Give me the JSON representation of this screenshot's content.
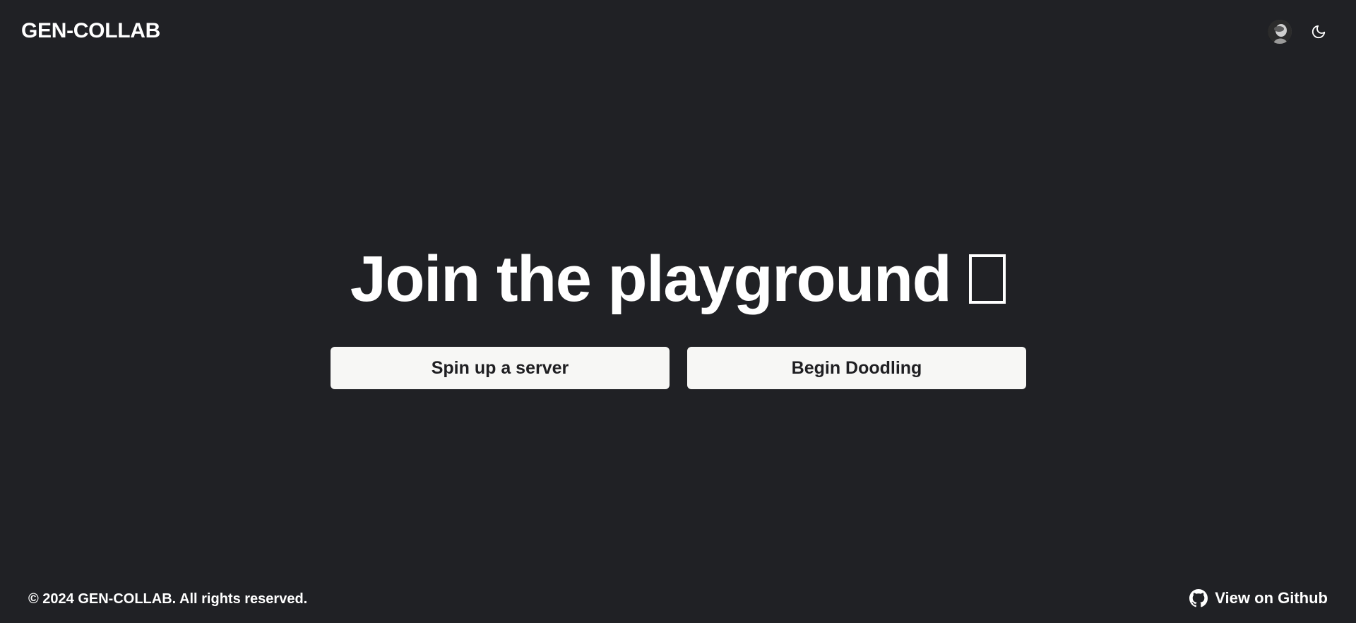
{
  "header": {
    "brand": "GEN-COLLAB",
    "avatar_icon": "user-avatar",
    "theme_icon": "moon-icon"
  },
  "hero": {
    "title": "Join the playground",
    "buttons": [
      {
        "label": "Spin up a server"
      },
      {
        "label": "Begin Doodling"
      }
    ]
  },
  "footer": {
    "copyright": "© 2024 GEN-COLLAB. All rights reserved.",
    "github_label": "View on Github",
    "github_icon": "github-icon"
  },
  "colors": {
    "background": "#202125",
    "text": "#ffffff",
    "button_bg": "#f7f7f5",
    "button_text": "#1f1f22"
  }
}
